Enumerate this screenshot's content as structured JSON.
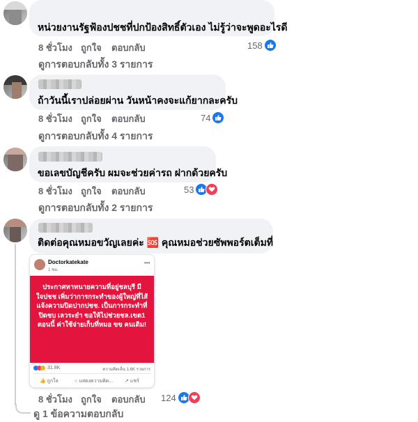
{
  "comments": [
    {
      "text": "หน่วยงานรัฐฟ้องปชชที่ปกป้องสิทธิ์ตัวเอง ไม่รู้ว่าจะพูดอะไรดี",
      "time": "8 ชั่วโมง",
      "like": "ถูกใจ",
      "reply": "ตอบกลับ",
      "reaction_count": "158",
      "reactions": [
        "like-icon"
      ],
      "view_replies": "ดูการตอบกลับทั้ง 3 รายการ"
    },
    {
      "text": "ถ้าวันนี้เราปล่อยผ่าน วันหน้าคงจะแก้ยากละครับ",
      "time": "8 ชั่วโมง",
      "like": "ถูกใจ",
      "reply": "ตอบกลับ",
      "reaction_count": "74",
      "reactions": [
        "like-icon"
      ],
      "view_replies": "ดูการตอบกลับทั้ง 4 รายการ"
    },
    {
      "text": "ขอเลขบัญชีครับ ผมจะช่วยค่ารถ ฝากด้วยครับ",
      "time": "8 ชั่วโมง",
      "like": "ถูกใจ",
      "reply": "ตอบกลับ",
      "reaction_count": "53",
      "reactions": [
        "like-icon",
        "love-icon"
      ],
      "view_replies": "ดูการตอบกลับทั้ง 2 รายการ"
    },
    {
      "text": "ติดต่อคุณหมอขวัญเลยค่ะ 🆘 คุณหมอช่วยซัพพอร์ตเต็มที่",
      "time": "8 ชั่วโมง",
      "like": "ถูกใจ",
      "reply": "ตอบกลับ",
      "reaction_count": "124",
      "reactions": [
        "like-icon",
        "love-icon"
      ],
      "view_replies": "ดู 1 ข้อความตอบกลับ"
    }
  ],
  "embedded_post": {
    "author": "Doctorkatekate",
    "time": "1 ชม.",
    "body": "ประกาศหาทนายความที่อยู่ชลบุรี มีใจปชช เพิ่มว่าการกระทำของผู้ใหญ่ที่ไส้แจ้งความปิดปากปชช. เป็นการกระทำที่ปิดชบ เลวระยำ ขอให้ไปช่วยชล.เขต1 ตอนนี้ ค่าใช้จ่ายเก็บที่หมอ ขข คนเดิม!",
    "reaction_count": "31.8K",
    "comments_count": "ความคิดเห็น 1.6K รายการ",
    "like": "ถูกใจ",
    "comment": "แสดงความคิด...",
    "share": "แชร์",
    "accent": "#e3143d"
  },
  "colors": {
    "bubble": "#f0f2f5",
    "meta": "#65676b",
    "like": "#1877f2",
    "love": "#f33e58"
  }
}
